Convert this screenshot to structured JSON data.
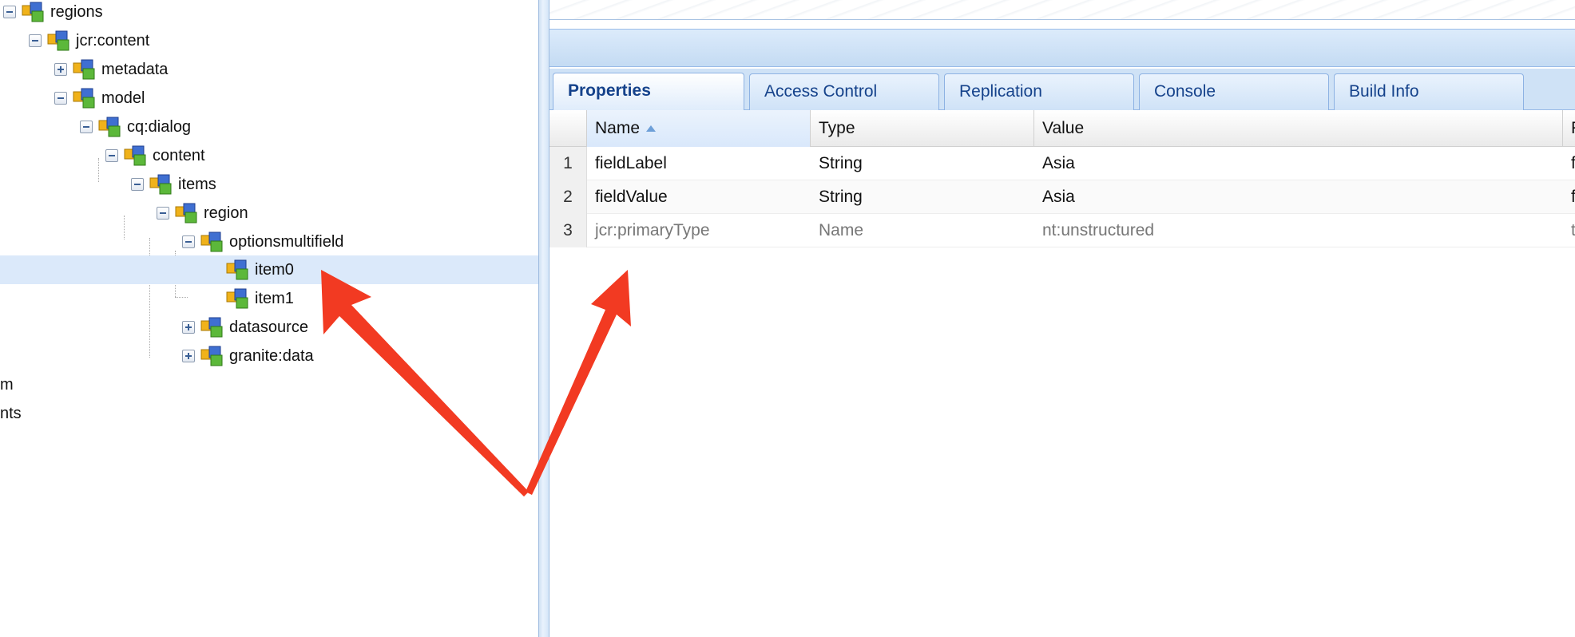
{
  "tree": {
    "nodes": [
      {
        "label": "regions",
        "toggle": "minus"
      },
      {
        "label": "jcr:content",
        "toggle": "minus"
      },
      {
        "label": "metadata",
        "toggle": "plus"
      },
      {
        "label": "model",
        "toggle": "minus"
      },
      {
        "label": "cq:dialog",
        "toggle": "minus"
      },
      {
        "label": "content",
        "toggle": "minus"
      },
      {
        "label": "items",
        "toggle": "minus"
      },
      {
        "label": "region",
        "toggle": "minus"
      },
      {
        "label": "optionsmultifield",
        "toggle": "minus"
      },
      {
        "label": "item0",
        "toggle": "none",
        "selected": true
      },
      {
        "label": "item1",
        "toggle": "none"
      },
      {
        "label": "datasource",
        "toggle": "plus"
      },
      {
        "label": "granite:data",
        "toggle": "plus"
      },
      {
        "label": "m",
        "toggle": "none"
      },
      {
        "label": "nts",
        "toggle": "none"
      }
    ]
  },
  "tabs": {
    "properties": "Properties",
    "access_control": "Access Control",
    "replication": "Replication",
    "console": "Console",
    "build_info": "Build Info"
  },
  "grid": {
    "columns": {
      "name": "Name",
      "type": "Type",
      "value": "Value",
      "extra": "F"
    },
    "rows": [
      {
        "num": "1",
        "name": "fieldLabel",
        "type": "String",
        "value": "Asia",
        "extra": "fa"
      },
      {
        "num": "2",
        "name": "fieldValue",
        "type": "String",
        "value": "Asia",
        "extra": "fa"
      },
      {
        "num": "3",
        "name": "jcr:primaryType",
        "type": "Name",
        "value": "nt:unstructured",
        "extra": "tr"
      }
    ]
  },
  "colors": {
    "arrow": "#f23a22",
    "selection": "#dbe9fa",
    "tab_text": "#15428b"
  }
}
